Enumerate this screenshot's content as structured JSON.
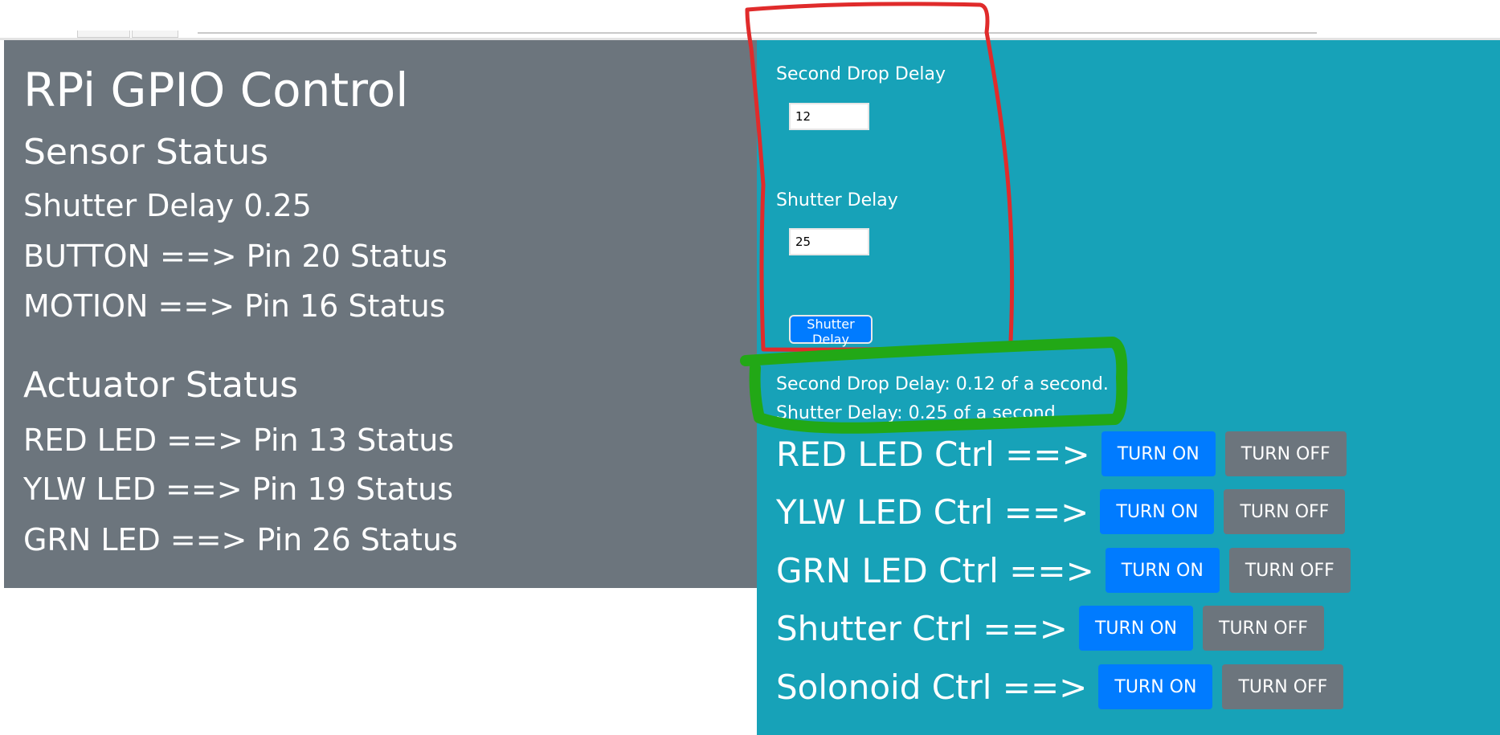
{
  "sensor_panel": {
    "title": "RPi GPIO Control",
    "sensor_heading": "Sensor Status",
    "shutter_delay_line": "Shutter Delay 0.25",
    "button_status": "BUTTON ==> Pin 20 Status",
    "motion_status": "MOTION ==> Pin 16 Status",
    "actuator_heading": "Actuator Status",
    "red_led_status": "RED LED ==> Pin 13 Status",
    "ylw_led_status": "YLW LED ==> Pin 19 Status",
    "grn_led_status": "GRN LED ==> Pin 26 Status"
  },
  "delay_form": {
    "second_drop_label": "Second Drop Delay",
    "second_drop_value": "12",
    "shutter_label": "Shutter Delay",
    "shutter_value": "25",
    "submit_label": "Shutter Delay"
  },
  "delay_info": {
    "second_drop_text": "Second Drop Delay: 0.12 of a second.",
    "shutter_text": "Shutter Delay: 0.25 of a second."
  },
  "controls": [
    {
      "label": "RED LED Ctrl ==>",
      "on": "TURN ON",
      "off": "TURN OFF"
    },
    {
      "label": "YLW LED Ctrl ==>",
      "on": "TURN ON",
      "off": "TURN OFF"
    },
    {
      "label": "GRN LED Ctrl ==>",
      "on": "TURN ON",
      "off": "TURN OFF"
    },
    {
      "label": "Shutter Ctrl ==>",
      "on": "TURN ON",
      "off": "TURN OFF"
    },
    {
      "label": "Solonoid Ctrl ==>",
      "on": "TURN ON",
      "off": "TURN OFF"
    }
  ],
  "colors": {
    "sensor_panel_bg": "#6c757d",
    "control_panel_bg": "#17a2b8",
    "on_button": "#007bff",
    "off_button": "#6c757d",
    "red_annotation": "#e02b2b",
    "green_annotation": "#22a816"
  }
}
